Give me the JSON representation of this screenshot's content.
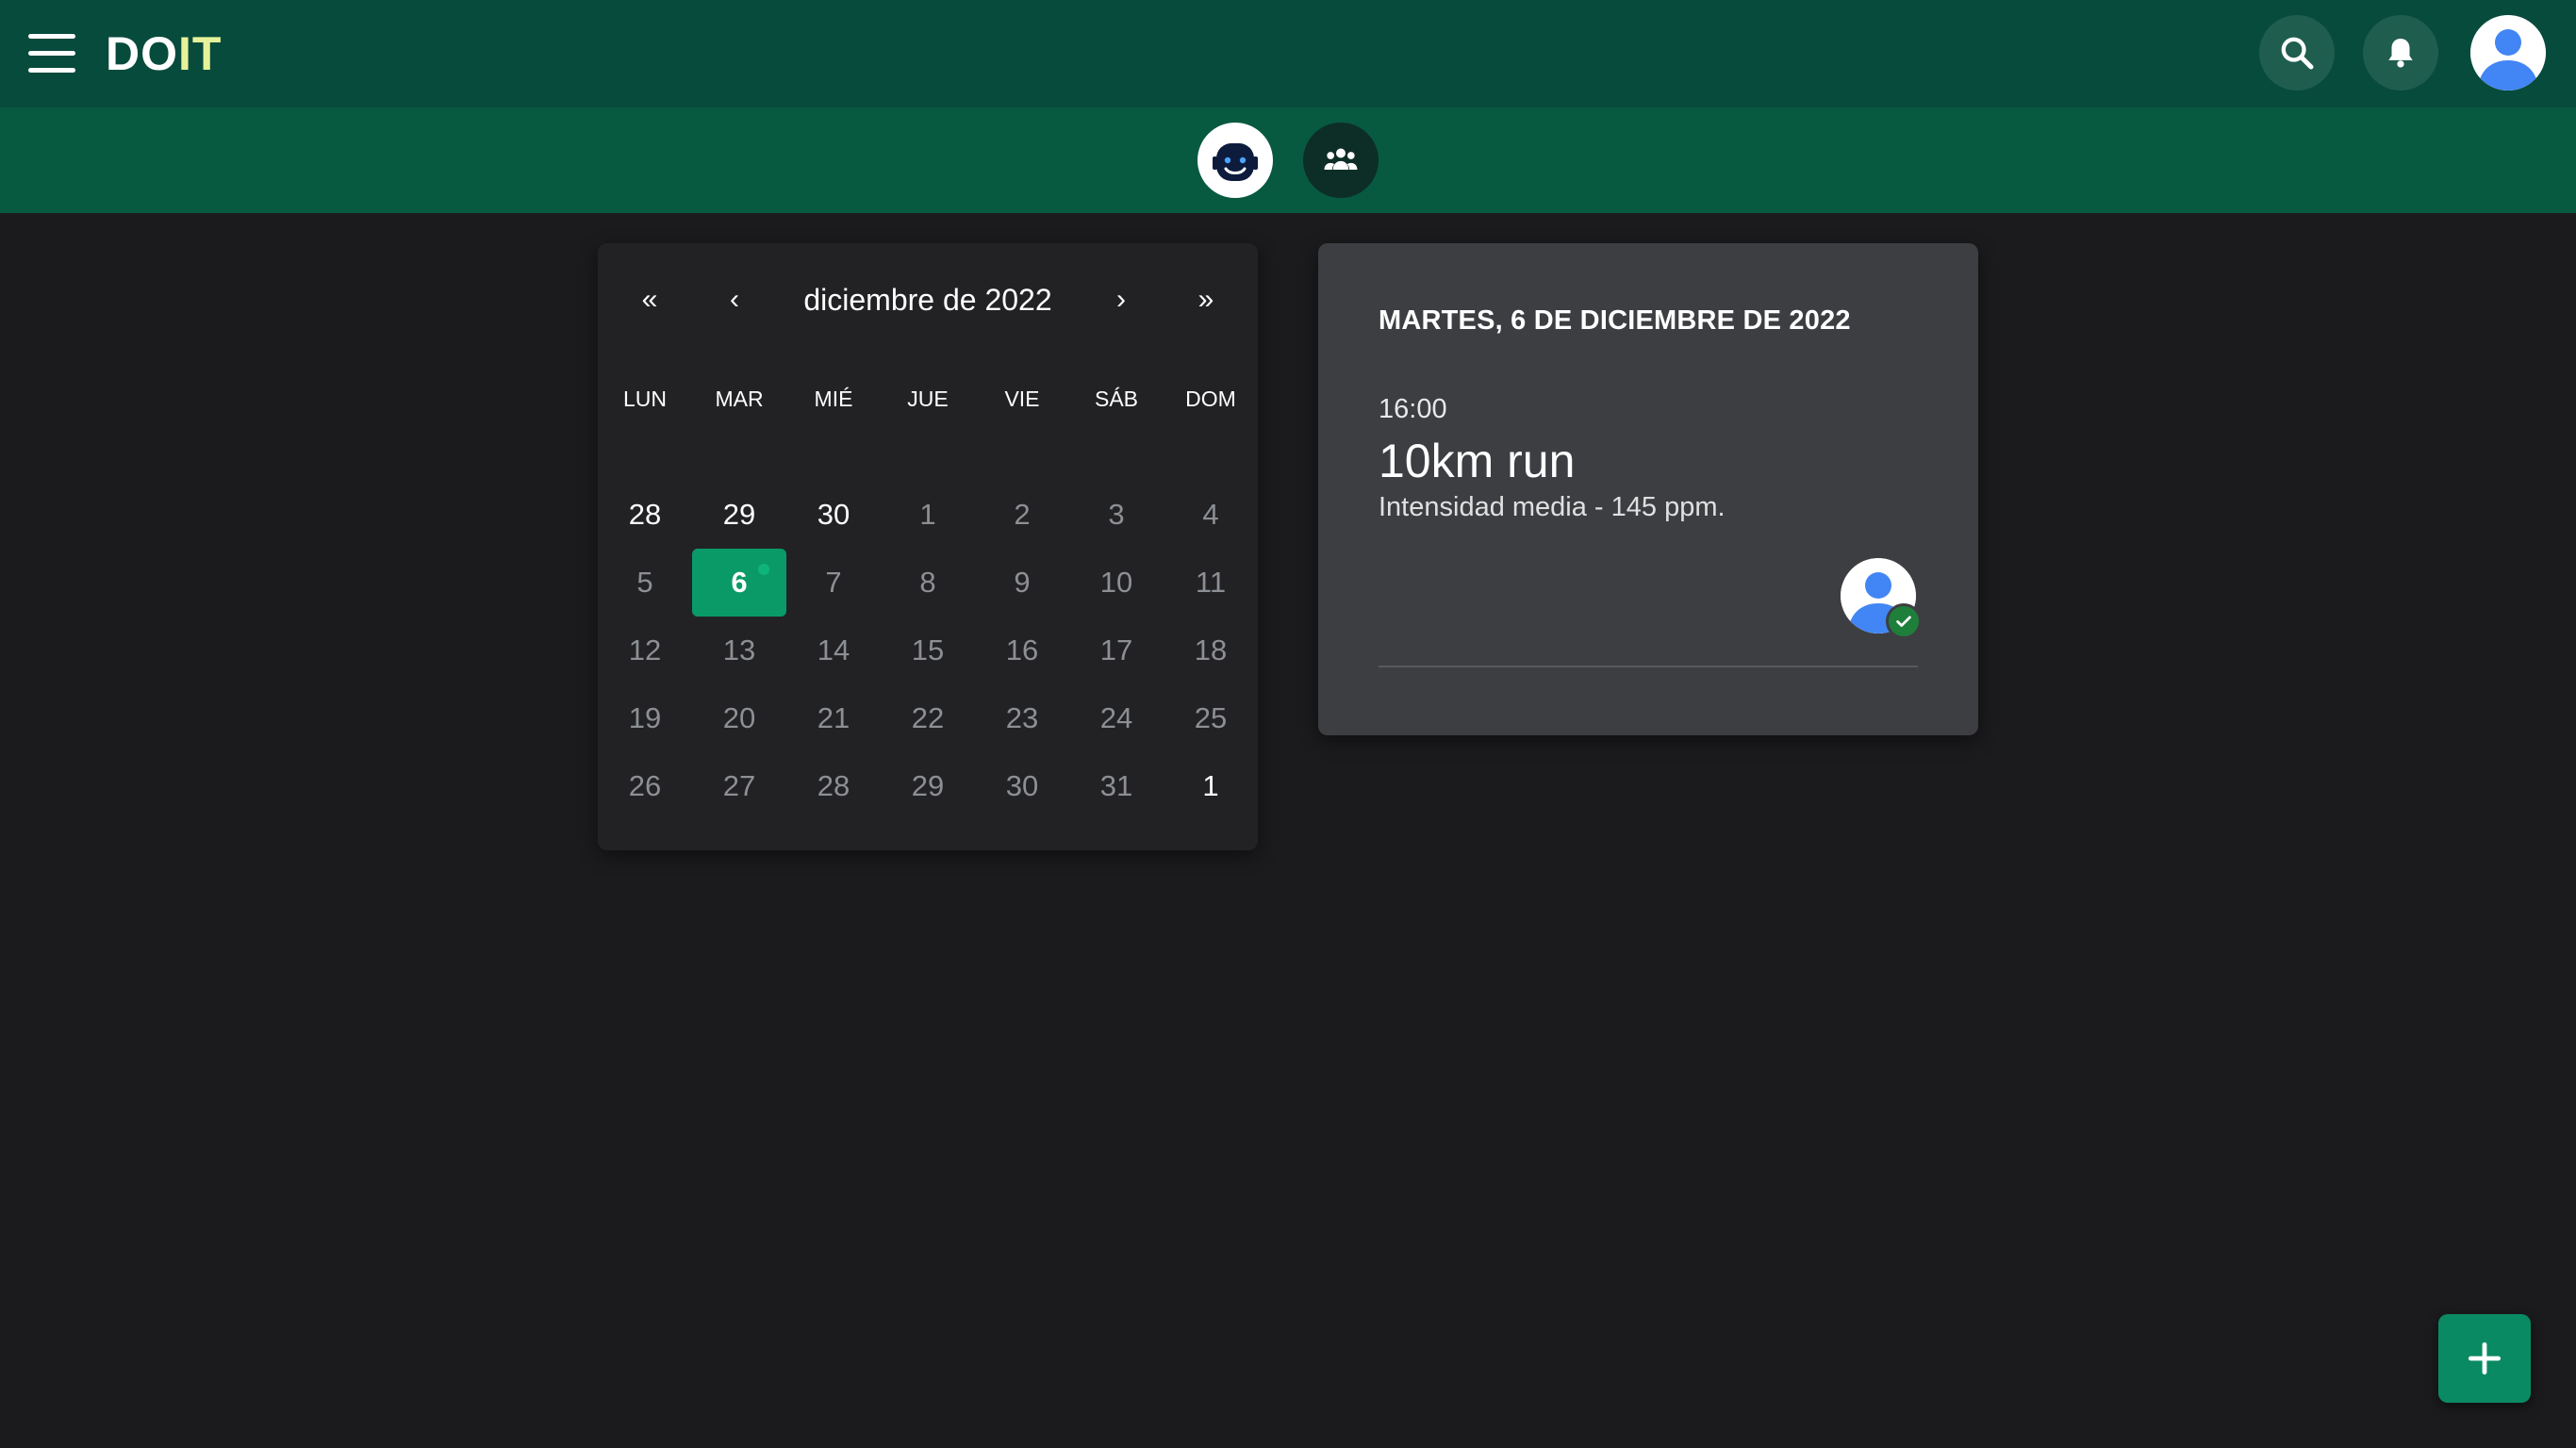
{
  "app": {
    "logo_primary": "DO",
    "logo_secondary": "IT"
  },
  "header": {
    "menu_icon": "hamburger-menu-icon",
    "search_icon": "search-icon",
    "notifications_icon": "bell-icon",
    "profile_icon": "user-avatar-icon"
  },
  "modes": [
    {
      "name": "robot-face-icon",
      "active": true
    },
    {
      "name": "group-icon",
      "active": false
    }
  ],
  "calendar": {
    "prev_year": "«",
    "prev_month": "‹",
    "title": "diciembre de 2022",
    "next_month": "›",
    "next_year": "»",
    "weekdays": [
      "LUN",
      "MAR",
      "MIÉ",
      "JUE",
      "VIE",
      "SÁB",
      "DOM"
    ],
    "weeks": [
      [
        "28",
        "29",
        "30",
        "1",
        "2",
        "3",
        "4"
      ],
      [
        "5",
        "6",
        "7",
        "8",
        "9",
        "10",
        "11"
      ],
      [
        "12",
        "13",
        "14",
        "15",
        "16",
        "17",
        "18"
      ],
      [
        "19",
        "20",
        "21",
        "22",
        "23",
        "24",
        "25"
      ],
      [
        "26",
        "27",
        "28",
        "29",
        "30",
        "31",
        "1"
      ]
    ],
    "selected_day": "6"
  },
  "event": {
    "date_heading": "MARTES, 6 DE DICIEMBRE DE 2022",
    "time": "16:00",
    "title": "10km run",
    "description": "Intensidad media - 145 ppm.",
    "participant_icon": "participant-avatar-icon",
    "confirmed_icon": "check-icon"
  },
  "fab": {
    "icon": "plus-icon"
  },
  "colors": {
    "topbar": "#074b3c",
    "subbar": "#075940",
    "background": "#1b1b1d",
    "accent": "#0a9a68",
    "logo_highlight": "#e6f29a"
  }
}
